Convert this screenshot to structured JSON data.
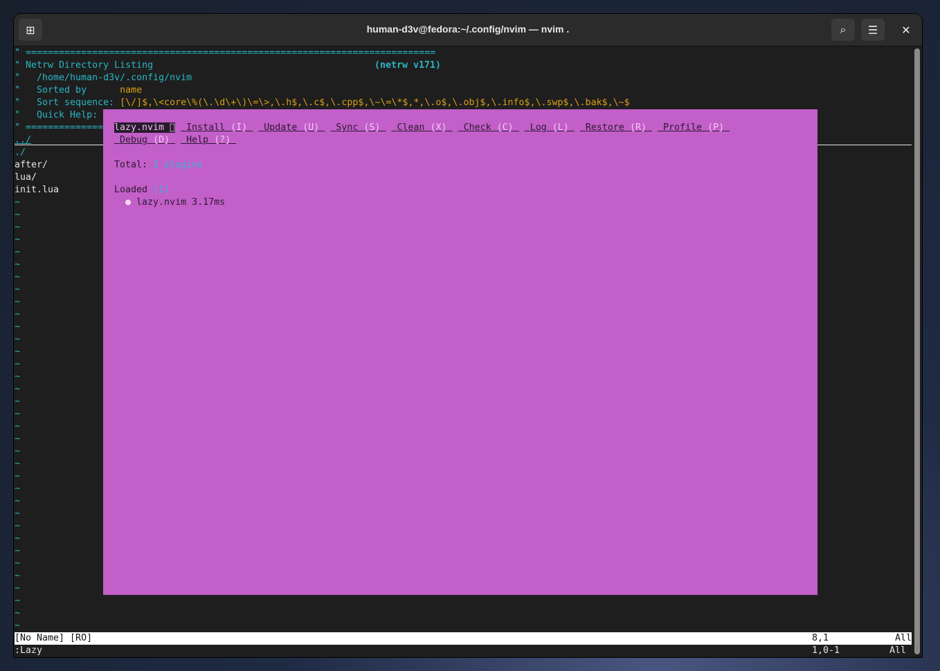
{
  "window": {
    "title": "human-d3v@fedora:~/.config/nvim — nvim .",
    "icons": [
      "new-tab-icon",
      "search-icon",
      "menu-icon",
      "close-icon"
    ]
  },
  "netrw": {
    "rule": "\" ==========================================================================",
    "rule_short": "\" ==============",
    "title": "\" Netrw Directory Listing",
    "version": "(netrw v171)",
    "path": "\"   /home/human-d3v/.config/nvim",
    "sorted_label": "\"   Sorted by      ",
    "sorted_value": "name",
    "sortseq_label": "\"   Sort sequence: ",
    "sortseq_value": "[\\/]$,\\<core\\%(\\.\\d\\+\\)\\=\\>,\\.h$,\\.c$,\\.cpp$,\\~\\=\\*$,*,\\.o$,\\.obj$,\\.info$,\\.swp$,\\.bak$,\\~$",
    "quickhelp": "\"   Quick Help: ",
    "entries": [
      "../",
      "./",
      "after/",
      "lua/",
      "init.lua"
    ],
    "tilde": "~"
  },
  "lazy": {
    "brand": "lazy.nvim 󰒲",
    "buttons": [
      {
        "label": "Install",
        "key": "(I)"
      },
      {
        "label": "Update",
        "key": "(U)"
      },
      {
        "label": "Sync",
        "key": "(S)"
      },
      {
        "label": "Clean",
        "key": "(X)"
      },
      {
        "label": "Check",
        "key": "(C)"
      },
      {
        "label": "Log",
        "key": "(L)"
      },
      {
        "label": "Restore",
        "key": "(R)"
      },
      {
        "label": "Profile",
        "key": "(P)"
      },
      {
        "label": "Debug",
        "key": "(D)"
      },
      {
        "label": "Help",
        "key": "(?)"
      }
    ],
    "total_label": "Total:",
    "total_value": "1 plugins",
    "loaded_label": "Loaded",
    "loaded_count": "(1)",
    "bullet": "●",
    "plugin": "lazy.nvim 3.17ms"
  },
  "statusline": {
    "left": "[No Name] [RO]",
    "pos": "8,1",
    "scroll": "All"
  },
  "cmdline": {
    "text": ":Lazy",
    "pos": "1,0-1",
    "scroll": "All"
  }
}
